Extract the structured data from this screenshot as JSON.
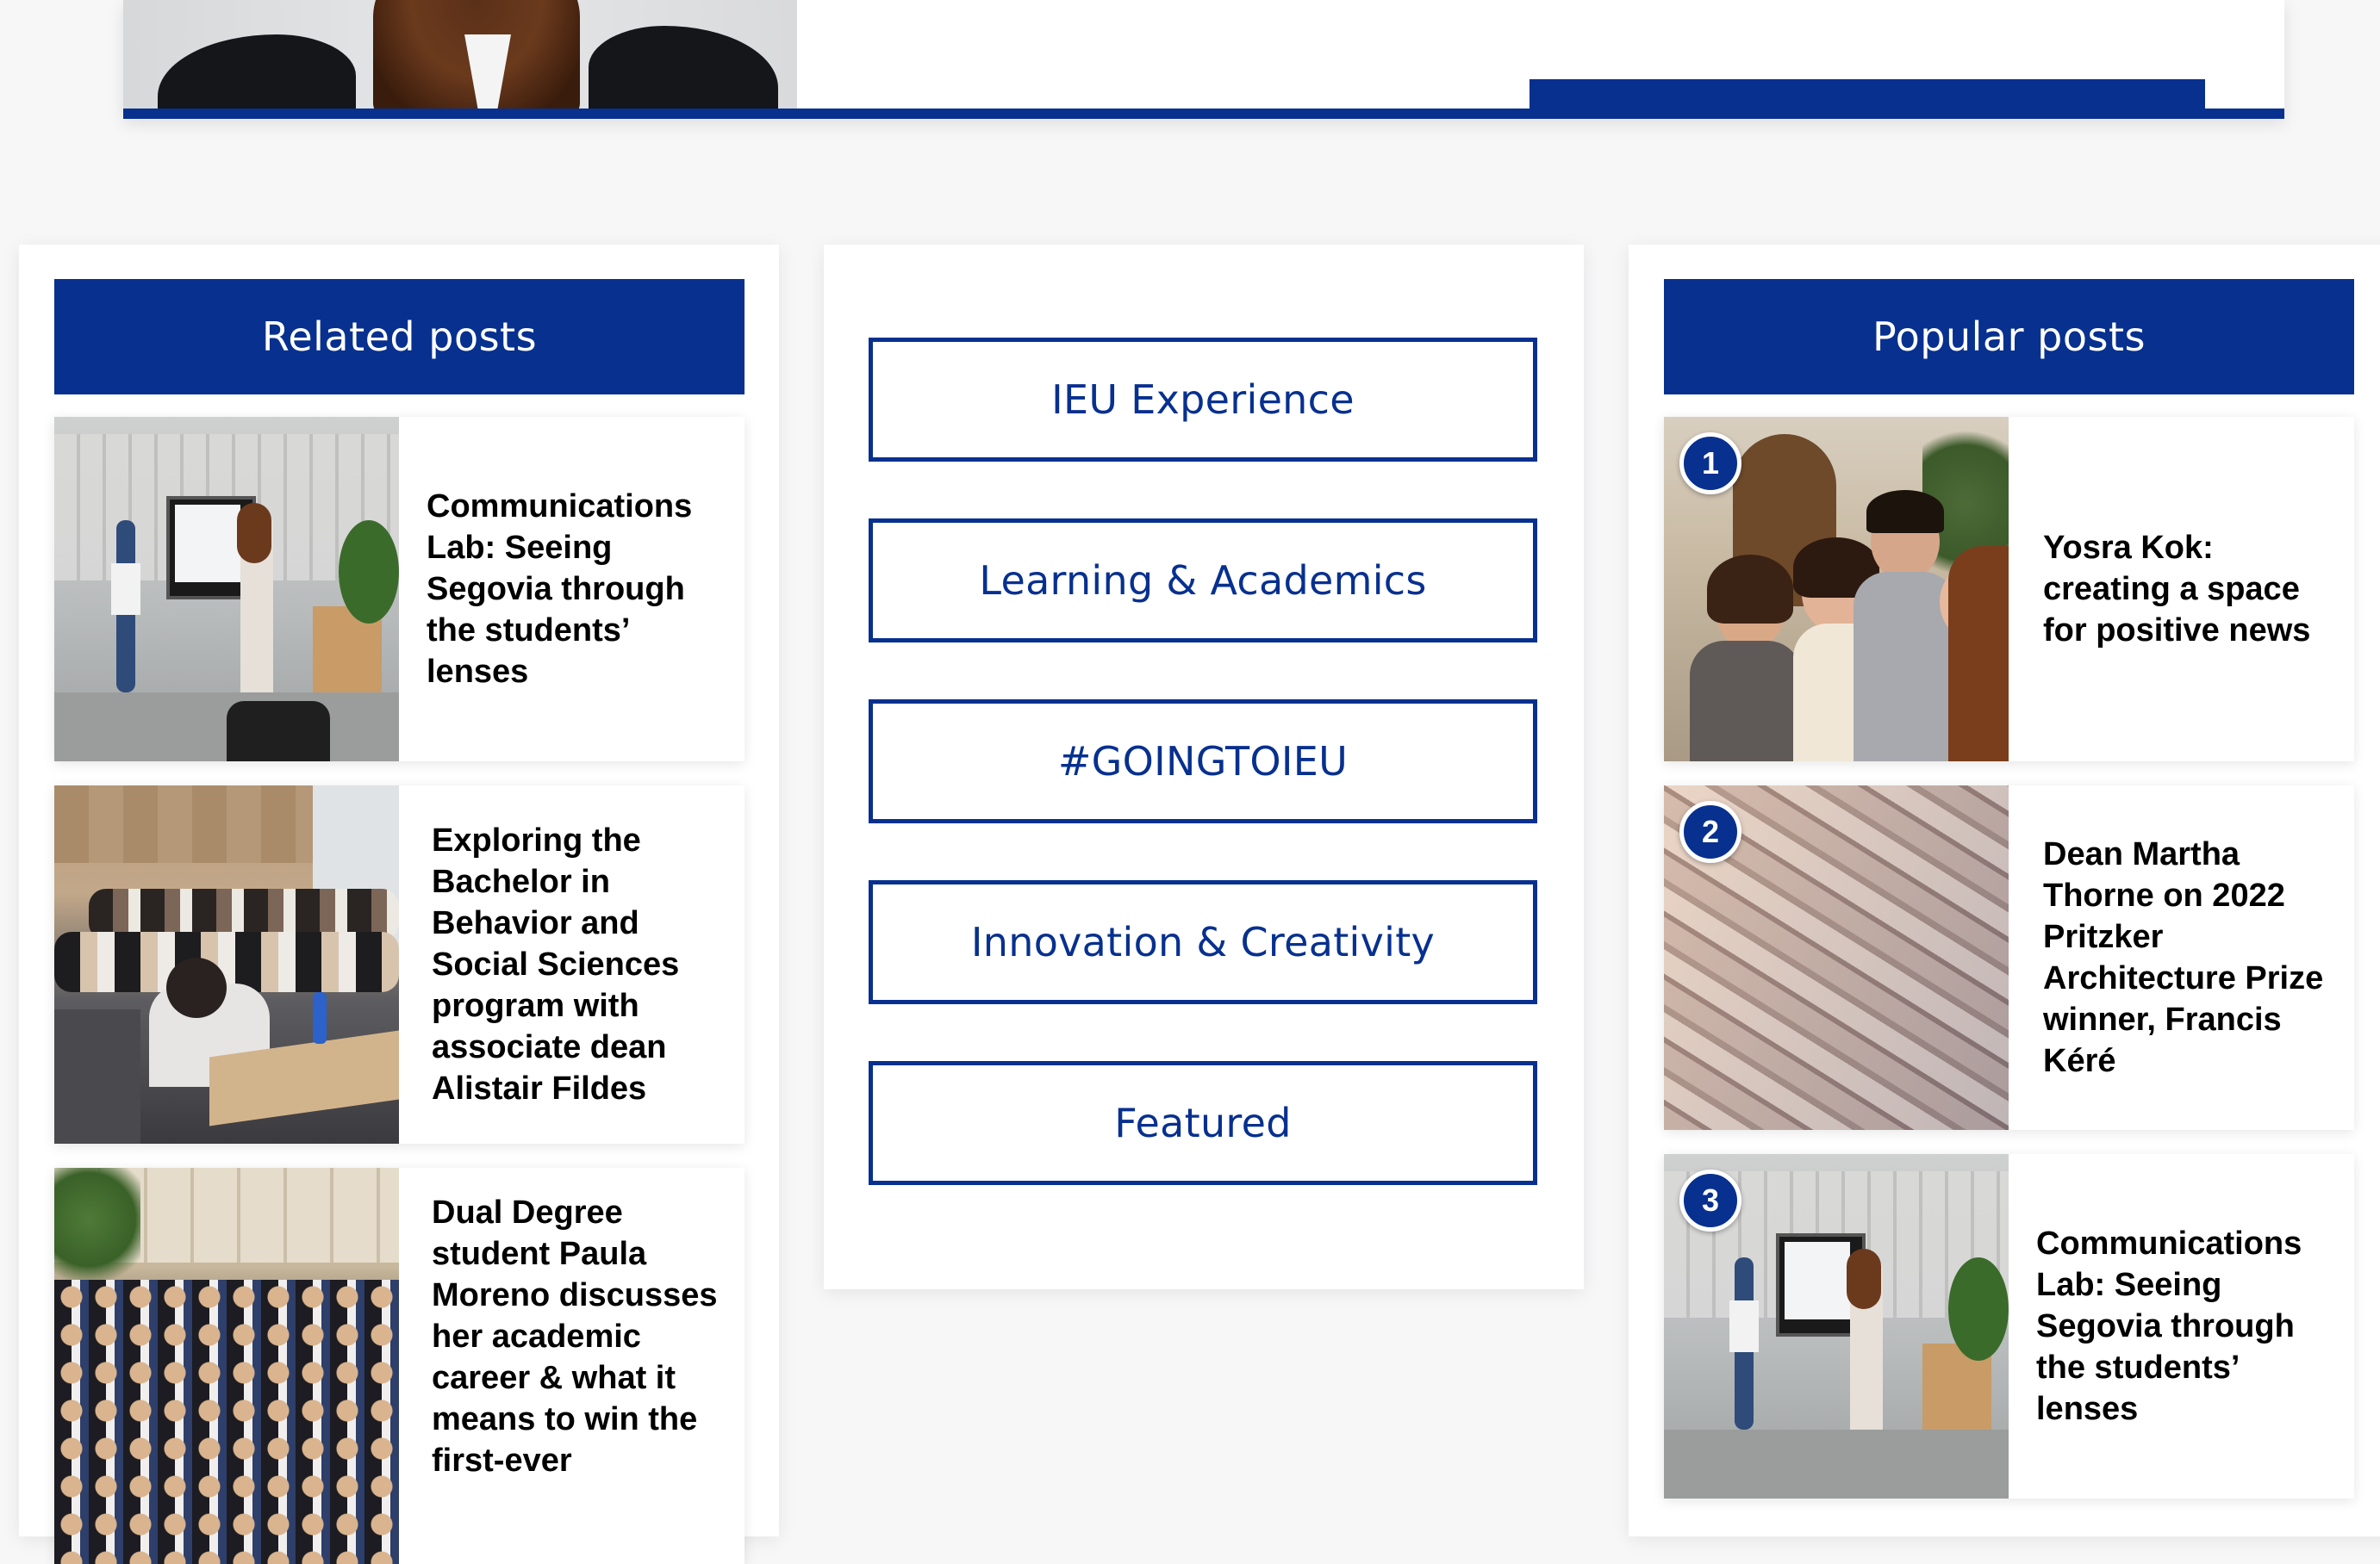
{
  "hero": {},
  "related": {
    "header": "Related posts",
    "posts": [
      {
        "title": "Communications Lab: Seeing Segovia through the students’ lenses"
      },
      {
        "title": "Exploring the Bachelor in Behavior and Social Sciences program with associate dean Alistair Fildes"
      },
      {
        "title": "Dual Degree student Paula Moreno discusses her academic career & what it means to win the first-ever"
      }
    ]
  },
  "categories": {
    "items": [
      {
        "label": "IEU Experience"
      },
      {
        "label": "Learning & Academics"
      },
      {
        "label": "#GOINGTOIEU"
      },
      {
        "label": "Innovation & Creativity"
      },
      {
        "label": "Featured"
      }
    ]
  },
  "popular": {
    "header": "Popular posts",
    "posts": [
      {
        "rank": "1",
        "title": "Yosra Kok: creating a space for positive news"
      },
      {
        "rank": "2",
        "title": "Dean Martha Thorne on 2022 Pritzker Architecture Prize winner, Francis Kéré"
      },
      {
        "rank": "3",
        "title": "Communications Lab: Seeing Segovia through the students’ lenses"
      }
    ]
  },
  "colors": {
    "brand_blue": "#07308f",
    "background": "#f7f7f8",
    "card": "#ffffff"
  }
}
